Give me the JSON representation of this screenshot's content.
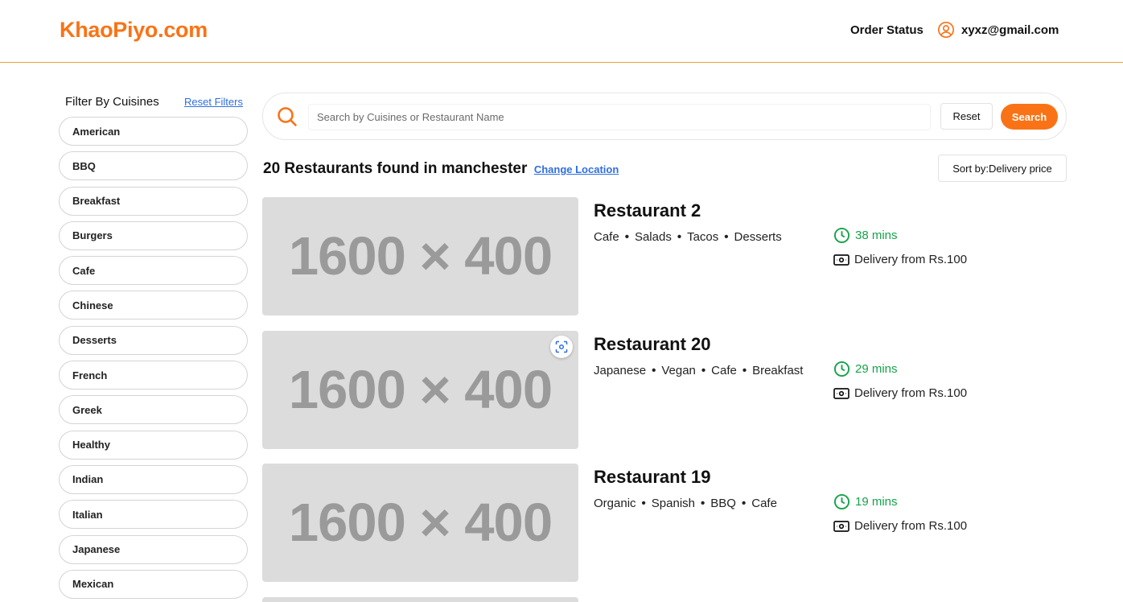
{
  "header": {
    "logo": "KhaoPiyo.com",
    "order_status": "Order Status",
    "user_email": "xyxz@gmail.com"
  },
  "filters": {
    "title": "Filter By Cuisines",
    "reset_label": "Reset Filters",
    "cuisines": [
      "American",
      "BBQ",
      "Breakfast",
      "Burgers",
      "Cafe",
      "Chinese",
      "Desserts",
      "French",
      "Greek",
      "Healthy",
      "Indian",
      "Italian",
      "Japanese",
      "Mexican"
    ]
  },
  "search": {
    "placeholder": "Search by Cuisines or Restaurant Name",
    "value": "",
    "reset_label": "Reset",
    "search_label": "Search"
  },
  "results": {
    "summary": "20 Restaurants found in manchester",
    "change_location": "Change Location",
    "sort_label": "Sort by:Delivery price"
  },
  "restaurants": [
    {
      "name": "Restaurant 2",
      "image_text": "1600 × 400",
      "cuisines": [
        "Cafe",
        "Salads",
        "Tacos",
        "Desserts"
      ],
      "time": "38 mins",
      "delivery": "Delivery from Rs.100"
    },
    {
      "name": "Restaurant 20",
      "image_text": "1600 × 400",
      "cuisines": [
        "Japanese",
        "Vegan",
        "Cafe",
        "Breakfast"
      ],
      "time": "29 mins",
      "delivery": "Delivery from Rs.100"
    },
    {
      "name": "Restaurant 19",
      "image_text": "1600 × 400",
      "cuisines": [
        "Organic",
        "Spanish",
        "BBQ",
        "Cafe"
      ],
      "time": "19 mins",
      "delivery": "Delivery from Rs.100"
    }
  ],
  "icons": {
    "user": "user-circle-icon",
    "search": "search-icon",
    "lens": "lens-scan-icon",
    "time": "clock-icon",
    "delivery": "cash-icon"
  },
  "colors": {
    "accent": "#f97316",
    "link": "#2f6fe0",
    "time_green": "#16a34a",
    "image_placeholder": "#dcdcdc"
  }
}
